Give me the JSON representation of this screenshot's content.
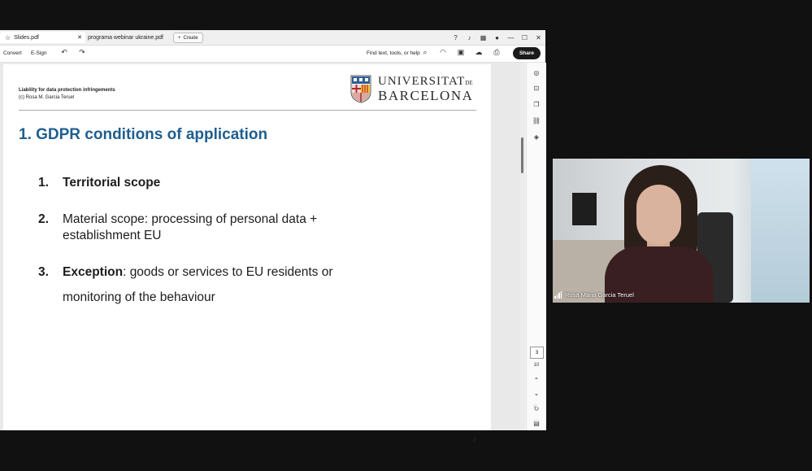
{
  "tabs": [
    {
      "label": "Slides.pdf",
      "active": true
    },
    {
      "label": "programa webinar ukraine.pdf",
      "active": false
    }
  ],
  "create_label": "Create",
  "toolbar": {
    "convert": "Convert",
    "esign": "E-Sign",
    "search_placeholder": "Find text, tools, or help",
    "share": "Share"
  },
  "slide": {
    "header_line1": "Liability for data protection infringements",
    "header_line2": "(c) Rosa M. Garcia Teruel",
    "logo_line1": "UNIVERSITAT",
    "logo_de": "DE",
    "logo_line2": "BARCELONA",
    "title": "1. GDPR conditions of application",
    "items": [
      {
        "num": "1.",
        "text_bold": "Territorial scope"
      },
      {
        "num": "2.",
        "line1": "Material scope: processing of personal data +",
        "line2": "establishment EU"
      },
      {
        "num": "3.",
        "bold": "Exception",
        "rest": ": goods or services to EU residents or",
        "line2": "monitoring of the behaviour"
      }
    ],
    "page_number": "2"
  },
  "page_nav": {
    "current": "3",
    "total": "10"
  },
  "video": {
    "participant_name": "Rosa Maria Garcia Teruel"
  },
  "colors": {
    "title_blue": "#1f5e8f",
    "share_bg": "#1a1a1a"
  }
}
